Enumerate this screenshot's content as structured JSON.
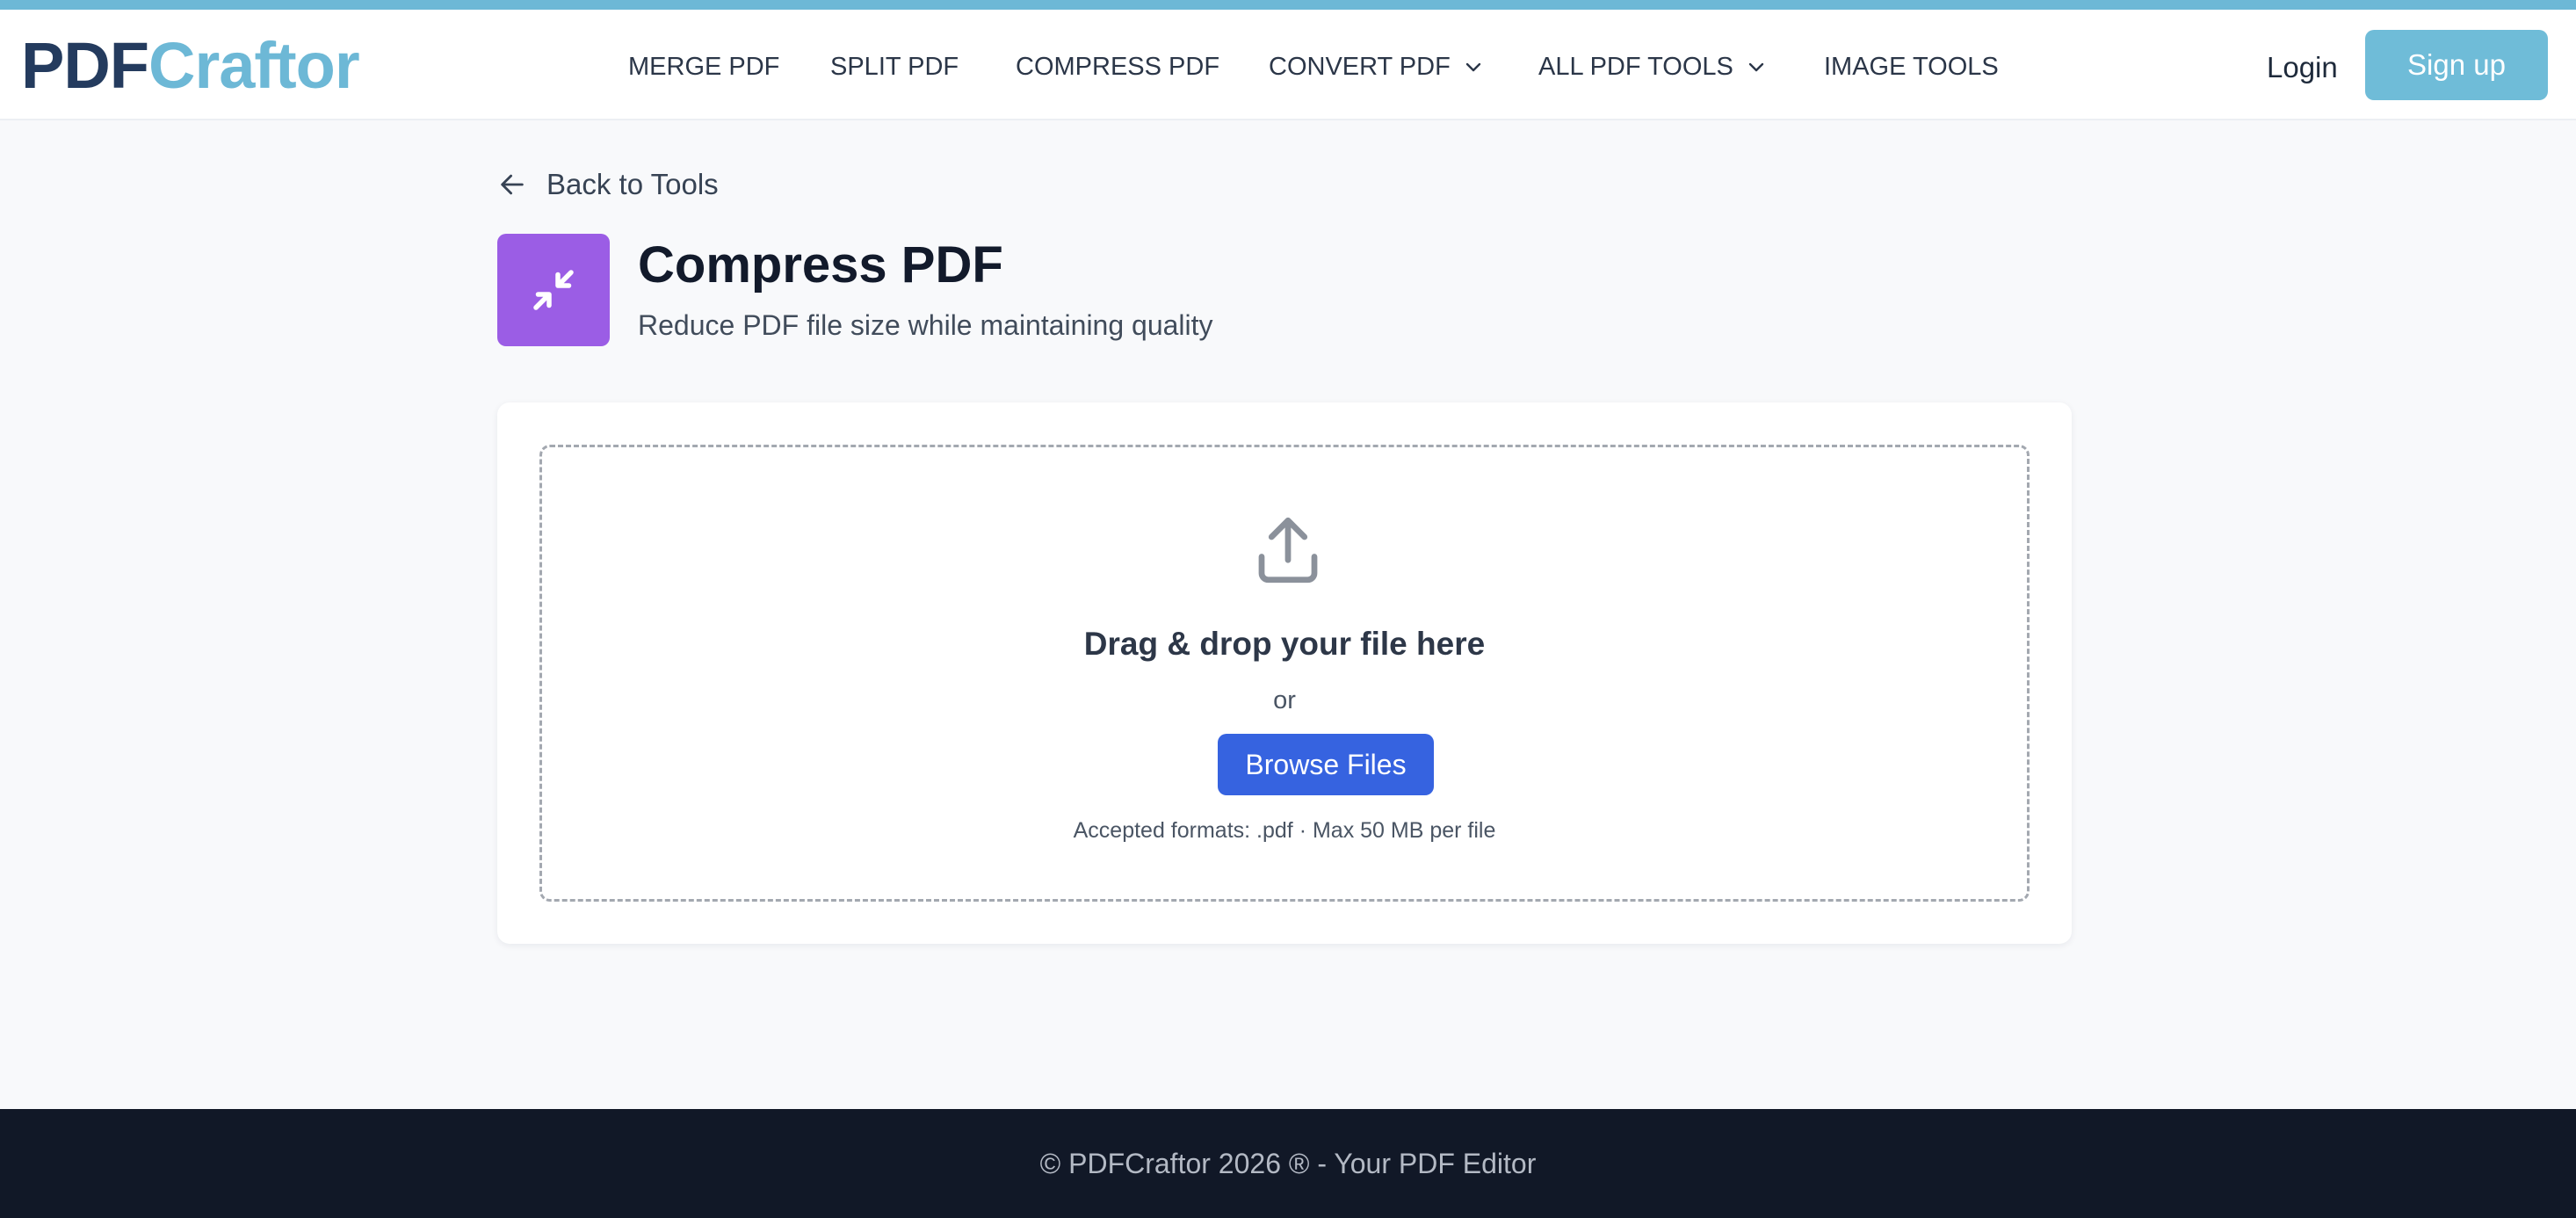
{
  "header": {
    "logo_part1": "PDF",
    "logo_part2": "Craftor",
    "nav": [
      {
        "label": "MERGE PDF"
      },
      {
        "label": "SPLIT PDF"
      },
      {
        "label": "COMPRESS PDF"
      },
      {
        "label": "CONVERT PDF",
        "has_dropdown": true
      },
      {
        "label": "ALL PDF TOOLS",
        "has_dropdown": true
      },
      {
        "label": "IMAGE TOOLS"
      }
    ],
    "login_label": "Login",
    "signup_label": "Sign up"
  },
  "back_link": {
    "label": "Back to Tools",
    "icon": "arrow-left-icon"
  },
  "tool": {
    "icon": "compress-arrows-icon",
    "title": "Compress PDF",
    "subtitle": "Reduce PDF file size while maintaining quality"
  },
  "upload": {
    "icon": "upload-icon",
    "title": "Drag & drop your file here",
    "or_text": "or",
    "browse_label": "Browse Files",
    "accepted_text": "Accepted formats: .pdf · Max 50 MB per file"
  },
  "footer": {
    "text": "© PDFCraftor 2026 ® - Your PDF Editor"
  },
  "colors": {
    "top_strip": "#6db8d6",
    "logo_dark": "#243b5e",
    "logo_accent": "#6db8d6",
    "signup_bg": "#6fbcd8",
    "tool_icon_bg": "#9b5de5",
    "browse_bg": "#3663e0",
    "footer_bg": "#111827"
  }
}
